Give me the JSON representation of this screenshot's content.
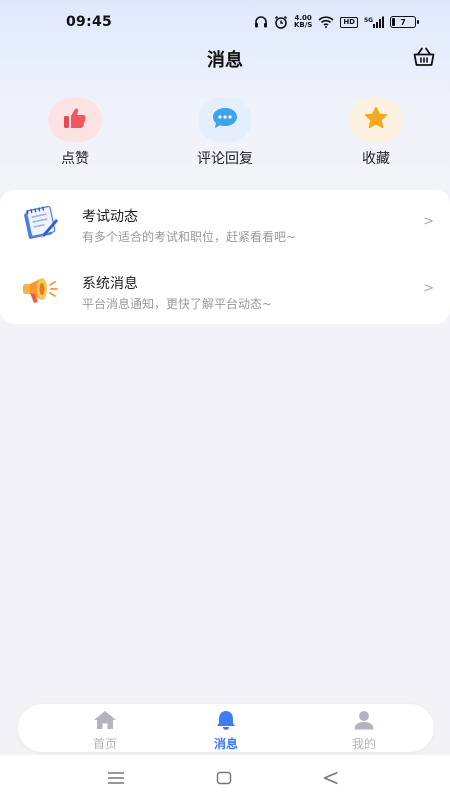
{
  "status_bar": {
    "time": "09:45",
    "net_speed_value": "4.00",
    "net_speed_unit": "KB/S",
    "hd_badge": "HD",
    "signal_label": "5G",
    "battery_level": "7"
  },
  "header": {
    "title": "消息"
  },
  "quick_actions": [
    {
      "label": "点赞",
      "icon": "thumbs-up-icon",
      "color": "#f0585d"
    },
    {
      "label": "评论回复",
      "icon": "chat-bubble-icon",
      "color": "#3ea3ee"
    },
    {
      "label": "收藏",
      "icon": "star-icon",
      "color": "#f7a823"
    }
  ],
  "messages": [
    {
      "title": "考试动态",
      "subtitle": "有多个适合的考试和职位，赶紧看看吧~",
      "icon": "notebook-pen-icon"
    },
    {
      "title": "系统消息",
      "subtitle": "平台消息通知，更快了解平台动态~",
      "icon": "megaphone-icon"
    }
  ],
  "tabs": [
    {
      "label": "首页",
      "icon": "home-icon",
      "active": false
    },
    {
      "label": "消息",
      "icon": "bell-icon",
      "active": true
    },
    {
      "label": "我的",
      "icon": "user-icon",
      "active": false
    }
  ],
  "colors": {
    "accent": "#3f7cf0",
    "inactive_tab": "#b4b4bc",
    "page_bg": "#f2f2f7"
  }
}
